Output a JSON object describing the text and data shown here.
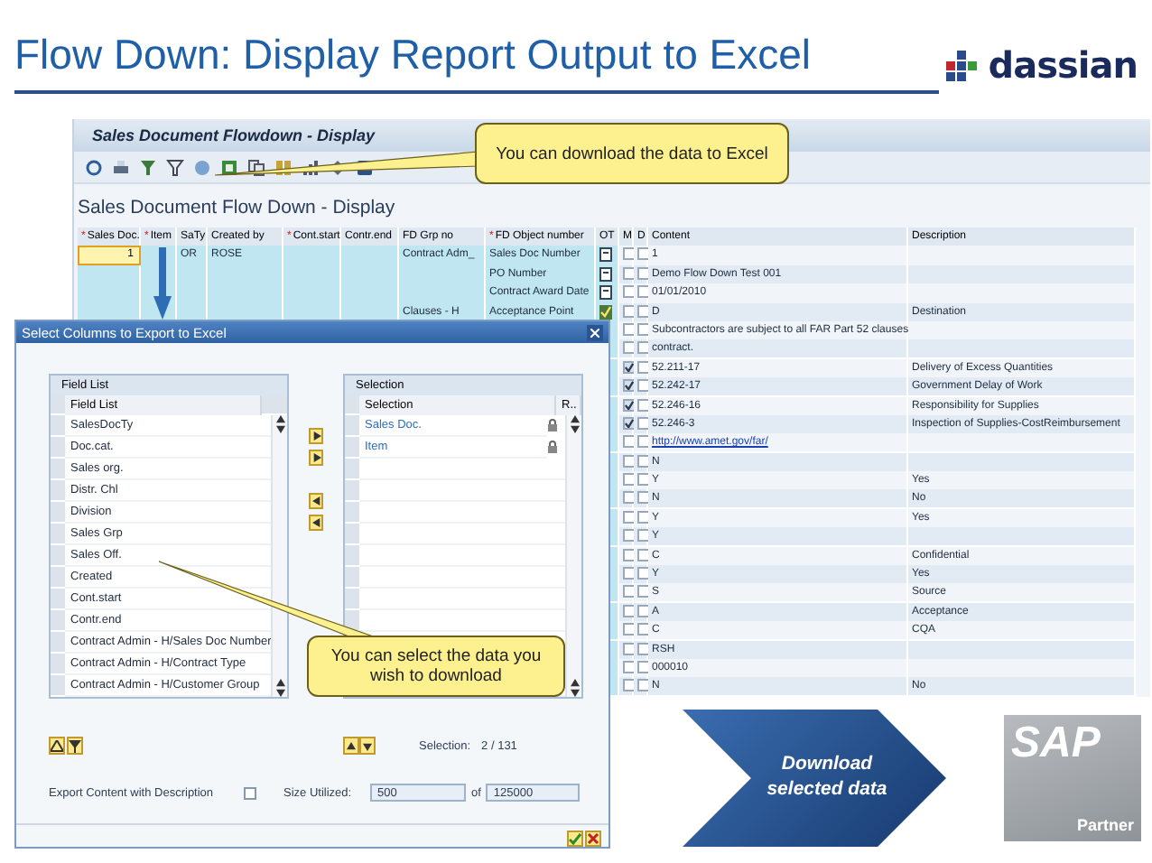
{
  "slide": {
    "title": "Flow Down: Display Report Output to Excel",
    "logo_text": "dassian",
    "step": "Download selected data",
    "partner_logo": {
      "brand": "SAP",
      "label": "Partner"
    }
  },
  "callouts": [
    {
      "text": "You can download the data to Excel"
    },
    {
      "text": "You can select the data you wish to download"
    }
  ],
  "window": {
    "title": "Sales Document Flowdown - Display",
    "heading": "Sales Document Flow Down - Display",
    "columns": [
      {
        "label": "Sales Doc.",
        "mark": "*"
      },
      {
        "label": "Item",
        "mark": "*"
      },
      {
        "label": "SaTy"
      },
      {
        "label": "Created by"
      },
      {
        "label": "Cont.start",
        "mark": "*"
      },
      {
        "label": "Contr.end"
      },
      {
        "label": "FD Grp no"
      },
      {
        "label": "FD Object number",
        "mark": "*"
      },
      {
        "label": "OT"
      },
      {
        "label": "M"
      },
      {
        "label": "D"
      },
      {
        "label": "Content"
      },
      {
        "label": "Description"
      }
    ],
    "rows": [
      {
        "sales_doc": {
          "value": "1",
          "focused": true
        },
        "saty": "OR",
        "created_by": "ROSE",
        "fd_grp_no": "Contract Adm_",
        "fd_object_number": "Sales Doc Number",
        "kind": "doc",
        "m_checked": false,
        "d_checked": false,
        "link": false,
        "content": "1"
      },
      {
        "fd_object_number": "PO Number",
        "kind": "doc",
        "m_checked": false,
        "d_checked": false,
        "link": false,
        "content": "Demo Flow Down Test 001"
      },
      {
        "fd_object_number": "Contract Award Date",
        "kind": "doc",
        "m_checked": false,
        "d_checked": false,
        "link": false,
        "content": "01/01/2010"
      },
      {
        "fd_grp_no": "Clauses - H",
        "fd_object_number": "Acceptance Point",
        "kind": "check",
        "m_checked": false,
        "d_checked": false,
        "link": false,
        "content": "D",
        "description": "Destination"
      },
      {
        "m_checked": false,
        "d_checked": false,
        "link": false,
        "content": "Subcontractors are subject to all FAR Part 52 clauses"
      },
      {
        "m_checked": false,
        "d_checked": false,
        "link": false,
        "content": "contract."
      },
      {
        "m_checked": true,
        "d_checked": false,
        "link": false,
        "content": "52.211-17",
        "description": "Delivery of Excess Quantities"
      },
      {
        "m_checked": true,
        "d_checked": false,
        "link": false,
        "content": "52.242-17",
        "description": "Government Delay of Work"
      },
      {
        "m_checked": true,
        "d_checked": false,
        "link": false,
        "content": "52.246-16",
        "description": "Responsibility for Supplies"
      },
      {
        "m_checked": true,
        "d_checked": false,
        "link": false,
        "content": "52.246-3",
        "description": "Inspection of Supplies-CostReimbursement"
      },
      {
        "m_checked": false,
        "d_checked": false,
        "link": true,
        "content": "http://www.amet.gov/far/"
      },
      {
        "m_checked": false,
        "d_checked": false,
        "link": false,
        "content": "N"
      },
      {
        "m_checked": false,
        "d_checked": false,
        "link": false,
        "content": "Y",
        "description": "Yes"
      },
      {
        "m_checked": false,
        "d_checked": false,
        "link": false,
        "content": "N",
        "description": "No"
      },
      {
        "m_checked": false,
        "d_checked": false,
        "link": false,
        "content": "Y",
        "description": "Yes"
      },
      {
        "m_checked": false,
        "d_checked": false,
        "link": false,
        "content": "Y"
      },
      {
        "m_checked": false,
        "d_checked": false,
        "link": false,
        "content": "C",
        "description": "Confidential"
      },
      {
        "m_checked": false,
        "d_checked": false,
        "link": false,
        "content": "Y",
        "description": "Yes"
      },
      {
        "m_checked": false,
        "d_checked": false,
        "link": false,
        "content": "S",
        "description": "Source"
      },
      {
        "m_checked": false,
        "d_checked": false,
        "link": false,
        "content": "A",
        "description": "Acceptance"
      },
      {
        "m_checked": false,
        "d_checked": false,
        "link": false,
        "content": "C",
        "description": "CQA"
      },
      {
        "m_checked": false,
        "d_checked": false,
        "link": false,
        "content": "RSH"
      },
      {
        "m_checked": false,
        "d_checked": false,
        "link": false,
        "content": "000010"
      },
      {
        "m_checked": false,
        "d_checked": false,
        "link": false,
        "content": "N",
        "description": "No"
      }
    ]
  },
  "dialog": {
    "title": "Select Columns to Export to Excel",
    "field_list": {
      "title": "Field List",
      "column": "Field List",
      "items": [
        "SalesDocTy",
        "Doc.cat.",
        "Sales org.",
        "Distr. Chl",
        "Division",
        "Sales Grp",
        "Sales Off.",
        "Created",
        "Cont.start",
        "Contr.end",
        "Contract Admin - H/Sales Doc Number",
        "Contract Admin - H/Contract Type",
        "Contract Admin - H/Customer Group"
      ]
    },
    "selection": {
      "title": "Selection",
      "columns": [
        "Selection",
        "R.."
      ],
      "items": [
        {
          "label": "Sales Doc.",
          "locked": true
        },
        {
          "label": "Item",
          "locked": true
        }
      ]
    },
    "selection_label": "Selection:",
    "selection_count": "2 / 131",
    "export_label": "Export Content with Description",
    "export_checked": false,
    "size_label": "Size Utilized:",
    "size_value": "500",
    "of_label": "of",
    "size_max": "125000"
  }
}
